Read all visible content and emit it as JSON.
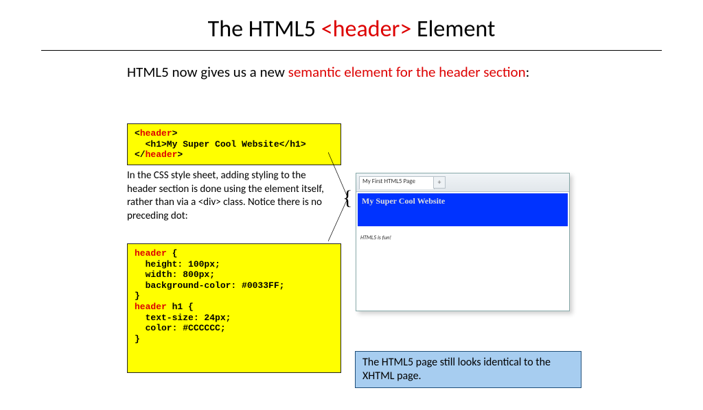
{
  "title": {
    "pre": "The HTML5 ",
    "red": "<header>",
    "post": " Element"
  },
  "subtitle": {
    "pre": "HTML5 now gives us a new ",
    "red": "semantic element for the header section",
    "post": ":"
  },
  "code1": {
    "l1open": "<",
    "l1tag": "header",
    "l1close": ">",
    "l2": "  <h1>My Super Cool Website</h1>",
    "l3open": "</",
    "l3tag": "header",
    "l3close": ">"
  },
  "body_text": "In the CSS style sheet, adding styling to the header section is done using the element itself, rather than via a <div> class. Notice there is no preceding dot:",
  "code2": {
    "s1": "header",
    "b1": " {",
    "l2": "  height: 100px;",
    "l3": "  width: 800px;",
    "l4": "  background-color: #0033FF;",
    "b2": "}",
    "s2": "header",
    "s2b": " h1 {",
    "l6": "  text-size: 24px;",
    "l7": "  color: #CCCCCC;",
    "b3": "}"
  },
  "browser": {
    "tab": "My First HTML5 Page",
    "plus": "+",
    "header_text": "My Super Cool Website",
    "body_text": "HTML5 is fun!"
  },
  "note": "The HTML5 page still looks identical to the XHTML page."
}
